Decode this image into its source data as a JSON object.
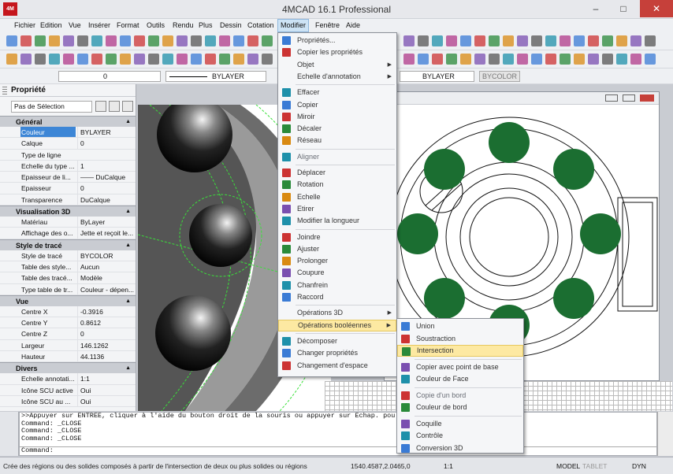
{
  "app": {
    "title": "4MCAD 16.1 Professional",
    "logo_text": "4M"
  },
  "window_controls": {
    "minimize": "–",
    "maximize": "□",
    "close": "✕"
  },
  "menubar": [
    "Fichier",
    "Edition",
    "Vue",
    "Insérer",
    "Format",
    "Outils",
    "Rendu",
    "Plus",
    "Dessin",
    "Cotation",
    "Modifier",
    "Fenêtre",
    "Aide"
  ],
  "layer_toolbar": {
    "layer_value": "0",
    "linetype_value": "BYLAYER",
    "lineweight_value": "BYLAYER",
    "plotstyle_value": "BYCOLOR"
  },
  "properties_panel": {
    "title": "Propriété",
    "selection": "Pas de Sélection",
    "sections": [
      {
        "title": "Général",
        "rows": [
          {
            "label": "Couleur",
            "value": "BYLAYER",
            "selected": true
          },
          {
            "label": "Calque",
            "value": "0"
          },
          {
            "label": "Type de ligne",
            "value": ""
          },
          {
            "label": "Echelle du type ...",
            "value": "1"
          },
          {
            "label": "Epaisseur de li...",
            "value": "—— DuCalque"
          },
          {
            "label": "Epaisseur",
            "value": "0"
          },
          {
            "label": "Transparence",
            "value": "DuCalque"
          }
        ]
      },
      {
        "title": "Visualisation 3D",
        "rows": [
          {
            "label": "Matériau",
            "value": "ByLayer"
          },
          {
            "label": "Affichage des o...",
            "value": "Jette et reçoit le..."
          }
        ]
      },
      {
        "title": "Style de tracé",
        "rows": [
          {
            "label": "Style de tracé",
            "value": "BYCOLOR"
          },
          {
            "label": "Table des style...",
            "value": "Aucun"
          },
          {
            "label": "Table des tracé...",
            "value": "Modèle"
          },
          {
            "label": "Type table de tr...",
            "value": "Couleur - dépen..."
          }
        ]
      },
      {
        "title": "Vue",
        "rows": [
          {
            "label": "Centre X",
            "value": "-0.3916"
          },
          {
            "label": "Centre Y",
            "value": "0.8612"
          },
          {
            "label": "Centre Z",
            "value": "0"
          },
          {
            "label": "Largeur",
            "value": "146.1262"
          },
          {
            "label": "Hauteur",
            "value": "44.1136"
          }
        ]
      },
      {
        "title": "Divers",
        "rows": [
          {
            "label": "Echelle annotati...",
            "value": "1:1"
          },
          {
            "label": "Icône SCU active",
            "value": "Oui"
          },
          {
            "label": "Icône SCU au ...",
            "value": "Oui"
          }
        ]
      }
    ]
  },
  "modifier_menu": [
    {
      "label": "Propriétés...",
      "icon": "properties-icon"
    },
    {
      "label": "Copier les propriétés",
      "icon": "match-properties-icon"
    },
    {
      "label": "Objet",
      "submenu": true
    },
    {
      "label": "Echelle d'annotation",
      "submenu": true
    },
    {
      "sep": true
    },
    {
      "label": "Effacer",
      "icon": "erase-icon"
    },
    {
      "label": "Copier",
      "icon": "copy-icon"
    },
    {
      "label": "Miroir",
      "icon": "mirror-icon"
    },
    {
      "label": "Décaler",
      "icon": "offset-icon"
    },
    {
      "label": "Réseau",
      "icon": "array-icon"
    },
    {
      "sep": true
    },
    {
      "label": "Aligner",
      "icon": "align-icon",
      "gray": true
    },
    {
      "sep": true
    },
    {
      "label": "Déplacer",
      "icon": "move-icon"
    },
    {
      "label": "Rotation",
      "icon": "rotate-icon"
    },
    {
      "label": "Echelle",
      "icon": "scale-icon"
    },
    {
      "label": "Etirer",
      "icon": "stretch-icon"
    },
    {
      "label": "Modifier la longueur",
      "icon": "lengthen-icon"
    },
    {
      "sep": true
    },
    {
      "label": "Joindre",
      "icon": "join-icon"
    },
    {
      "label": "Ajuster",
      "icon": "trim-icon"
    },
    {
      "label": "Prolonger",
      "icon": "extend-icon"
    },
    {
      "label": "Coupure",
      "icon": "break-icon"
    },
    {
      "label": "Chanfrein",
      "icon": "chamfer-icon"
    },
    {
      "label": "Raccord",
      "icon": "fillet-icon"
    },
    {
      "sep": true
    },
    {
      "label": "Opérations 3D",
      "submenu": true
    },
    {
      "label": "Opérations booléennes",
      "submenu": true,
      "highlighted": true
    },
    {
      "sep": true
    },
    {
      "label": "Décomposer",
      "icon": "explode-icon"
    },
    {
      "label": "Changer propriétés",
      "icon": "change-properties-icon"
    },
    {
      "label": "Changement d'espace",
      "icon": "change-space-icon"
    }
  ],
  "boolean_submenu": [
    {
      "label": "Union",
      "icon": "union-icon"
    },
    {
      "label": "Soustraction",
      "icon": "subtract-icon"
    },
    {
      "label": "Intersection",
      "icon": "intersect-icon",
      "highlighted": true
    },
    {
      "sep": true
    },
    {
      "label": "Copier avec point de base",
      "icon": "copy-base-icon"
    },
    {
      "label": "Couleur de Face",
      "icon": "face-color-icon"
    },
    {
      "sep": true
    },
    {
      "label": "Copie d'un bord",
      "icon": "copy-edge-icon",
      "gray": true
    },
    {
      "label": "Couleur de bord",
      "icon": "edge-color-icon"
    },
    {
      "sep": true
    },
    {
      "label": "Coquille",
      "icon": "shell-icon"
    },
    {
      "label": "Contrôle",
      "icon": "check-icon"
    },
    {
      "label": "Conversion 3D",
      "icon": "convert-3d-icon"
    }
  ],
  "command_line": {
    "lines": [
      ">>Appuyer sur ENTREE, cliquer à l'aide du bouton droit de la souris ou appuyer sur Echap. pou",
      "Command: _CLOSE",
      "Command: _CLOSE",
      "Command: _CLOSE"
    ],
    "prompt": "Command:"
  },
  "status_bar": {
    "message": "Crée des régions ou des solides composés à partir de l'intersection de deux ou plus solides ou régions",
    "coordinates": "1540.4587,2.0465,0",
    "scale": "1:1",
    "model": "MODEL",
    "tablet": "TABLET",
    "dyn": "DYN"
  },
  "colors": {
    "accent_green": "#1b6e31",
    "highlight": "#fde9a2",
    "selection_blue": "#3d86d6"
  }
}
